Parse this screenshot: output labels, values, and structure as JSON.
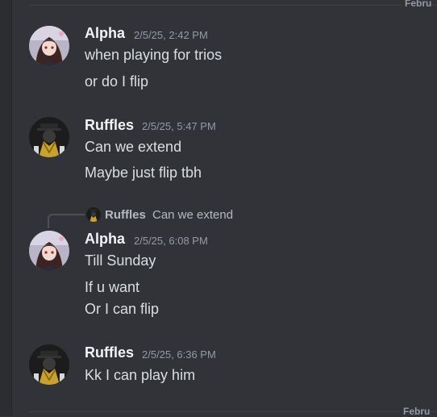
{
  "dividers": {
    "top_label": "Febru",
    "bottom_label": "Febru"
  },
  "messages": [
    {
      "author": "Alpha",
      "timestamp": "2/5/25, 2:42 PM",
      "lines": [
        "when playing for trios",
        "or do I flip"
      ],
      "avatar_icon": "anime-girl-avatar"
    },
    {
      "author": "Ruffles",
      "timestamp": "2/5/25, 5:47 PM",
      "lines": [
        "Can we extend",
        "Maybe just flip tbh"
      ],
      "avatar_icon": "masked-figure-avatar"
    },
    {
      "reply": {
        "author": "Ruffles",
        "text": "Can we extend"
      },
      "author": "Alpha",
      "timestamp": "2/5/25, 6:08 PM",
      "lines": [
        "Till Sunday",
        "If u want",
        "Or I can flip"
      ],
      "avatar_icon": "anime-girl-avatar"
    },
    {
      "author": "Ruffles",
      "timestamp": "2/5/25, 6:36 PM",
      "lines": [
        "Kk I can play him"
      ],
      "avatar_icon": "masked-figure-avatar"
    }
  ],
  "colors": {
    "background": "#313338",
    "username": "#f2f3f5",
    "timestamp": "#949ba4",
    "text": "#dbdee1"
  }
}
